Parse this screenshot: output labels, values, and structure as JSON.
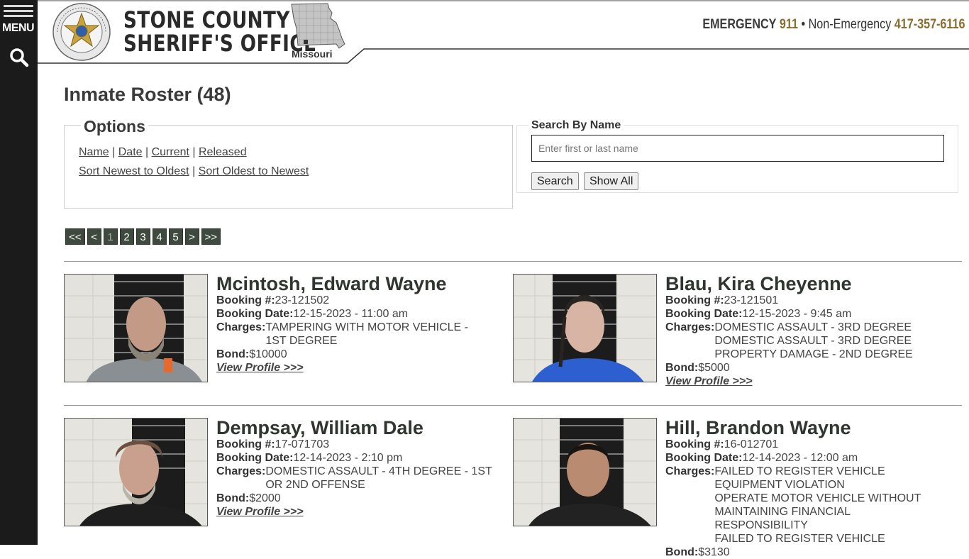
{
  "sidebar": {
    "menu_label": "MENU"
  },
  "header": {
    "office_line1": "STONE COUNTY",
    "office_line2": "SHERIFF'S OFFICE",
    "state_label": "Missouri",
    "emergency_label": "EMERGENCY",
    "emergency_number": "911",
    "separator": "•",
    "non_emergency_label": "Non-Emergency",
    "non_emergency_number": "417-357-6116"
  },
  "page": {
    "title": "Inmate Roster (48)"
  },
  "options": {
    "legend": "Options",
    "sort_links": [
      "Name",
      "Date",
      "Current",
      "Released"
    ],
    "order_links": [
      "Sort Newest to Oldest",
      "Sort Oldest to Newest"
    ]
  },
  "search": {
    "legend": "Search By Name",
    "placeholder": "Enter first or last name",
    "search_button": "Search",
    "show_all_button": "Show All"
  },
  "pager": {
    "items": [
      "<<",
      "<",
      "1",
      "2",
      "3",
      "4",
      "5",
      ">",
      ">>"
    ],
    "current": "1"
  },
  "labels": {
    "booking_num": "Booking #:",
    "booking_date": "Booking Date:",
    "charges": "Charges:",
    "bond": "Bond:",
    "view_profile": "View Profile >>>"
  },
  "inmates": [
    {
      "name": "Mcintosh, Edward Wayne",
      "booking_num": "23-121502",
      "booking_date": "12-15-2023 - 11:00 am",
      "charges": [
        "TAMPERING WITH MOTOR VEHICLE - 1ST DEGREE"
      ],
      "bond": "$10000"
    },
    {
      "name": "Blau, Kira Cheyenne",
      "booking_num": "23-121501",
      "booking_date": "12-15-2023 - 9:45 am",
      "charges": [
        "DOMESTIC ASSAULT - 3RD DEGREE",
        "DOMESTIC ASSAULT - 3RD DEGREE",
        "PROPERTY DAMAGE - 2ND DEGREE"
      ],
      "bond": "$5000"
    },
    {
      "name": "Dempsay, William Dale",
      "booking_num": "17-071703",
      "booking_date": "12-14-2023 - 2:10 pm",
      "charges": [
        "DOMESTIC ASSAULT - 4TH DEGREE - 1ST OR 2ND OFFENSE"
      ],
      "bond": "$2000"
    },
    {
      "name": "Hill, Brandon Wayne",
      "booking_num": "16-012701",
      "booking_date": "12-14-2023 - 12:00 am",
      "charges": [
        "FAILED TO REGISTER VEHICLE",
        "EQUIPMENT VIOLATION",
        "OPERATE MOTOR VEHICLE WITHOUT MAINTAINING FINANCIAL RESPONSIBILITY",
        "FAILED TO REGISTER VEHICLE"
      ],
      "bond": "$3130"
    }
  ]
}
